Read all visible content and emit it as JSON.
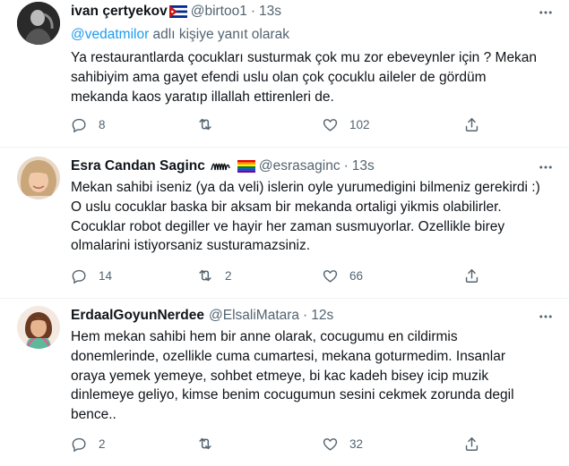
{
  "tweets": [
    {
      "name": "ivan çertyekov",
      "handle": "@birtoo1",
      "sep": "·",
      "time": "13s",
      "replying_to_user": "@vedatmilor",
      "replying_to_suffix": " adlı kişiye yanıt olarak",
      "text": "Ya restaurantlarda çocukları susturmak çok mu zor ebeveynler için ? Mekan\nsahibiyim ama gayet efendi uslu olan çok çocuklu aileler de gördüm\nmekanda kaos yaratıp illallah ettirenleri de.",
      "replies": "8",
      "retweets": "",
      "likes": "102"
    },
    {
      "name": "Esra Candan Saginc",
      "handle": "@esrasaginc",
      "sep": "·",
      "time": "13s",
      "text": "Mekan sahibi iseniz (ya da veli) islerin oyle yurumedigini bilmeniz gerekirdi :)\nO uslu cocuklar baska bir aksam bir mekanda ortaligi yikmis olabilirler.\nCocuklar robot degiller ve hayir her zaman susmuyorlar. Ozellikle birey\nolmalarini istiyorsaniz susturamazsiniz.",
      "replies": "14",
      "retweets": "2",
      "likes": "66"
    },
    {
      "name": "ErdaalGoyunNerdee",
      "handle": "@ElsaliMatara",
      "sep": "·",
      "time": "12s",
      "text": "Hem mekan sahibi hem bir anne olarak, cocugumu en cildirmis\ndonemlerinde, ozellikle cuma cumartesi, mekana goturmedim. Insanlar\noraya yemek yemeye, sohbet etmeye, bi kac kadeh bisey icip muzik\ndinlemeye geliyo, kimse benim cocugumun sesini cekmek zorunda degil\nbence..",
      "replies": "2",
      "retweets": "",
      "likes": "32"
    }
  ],
  "icons": [
    "reply-icon",
    "retweet-icon",
    "like-icon",
    "share-icon",
    "more-icon",
    "cuba-flag-icon",
    "handwriting-icon",
    "rainbow-flag-icon"
  ],
  "colors": {
    "text": "#0f1419",
    "secondary": "#536471",
    "link": "#1d9bf0",
    "divider": "#eff3f4"
  }
}
